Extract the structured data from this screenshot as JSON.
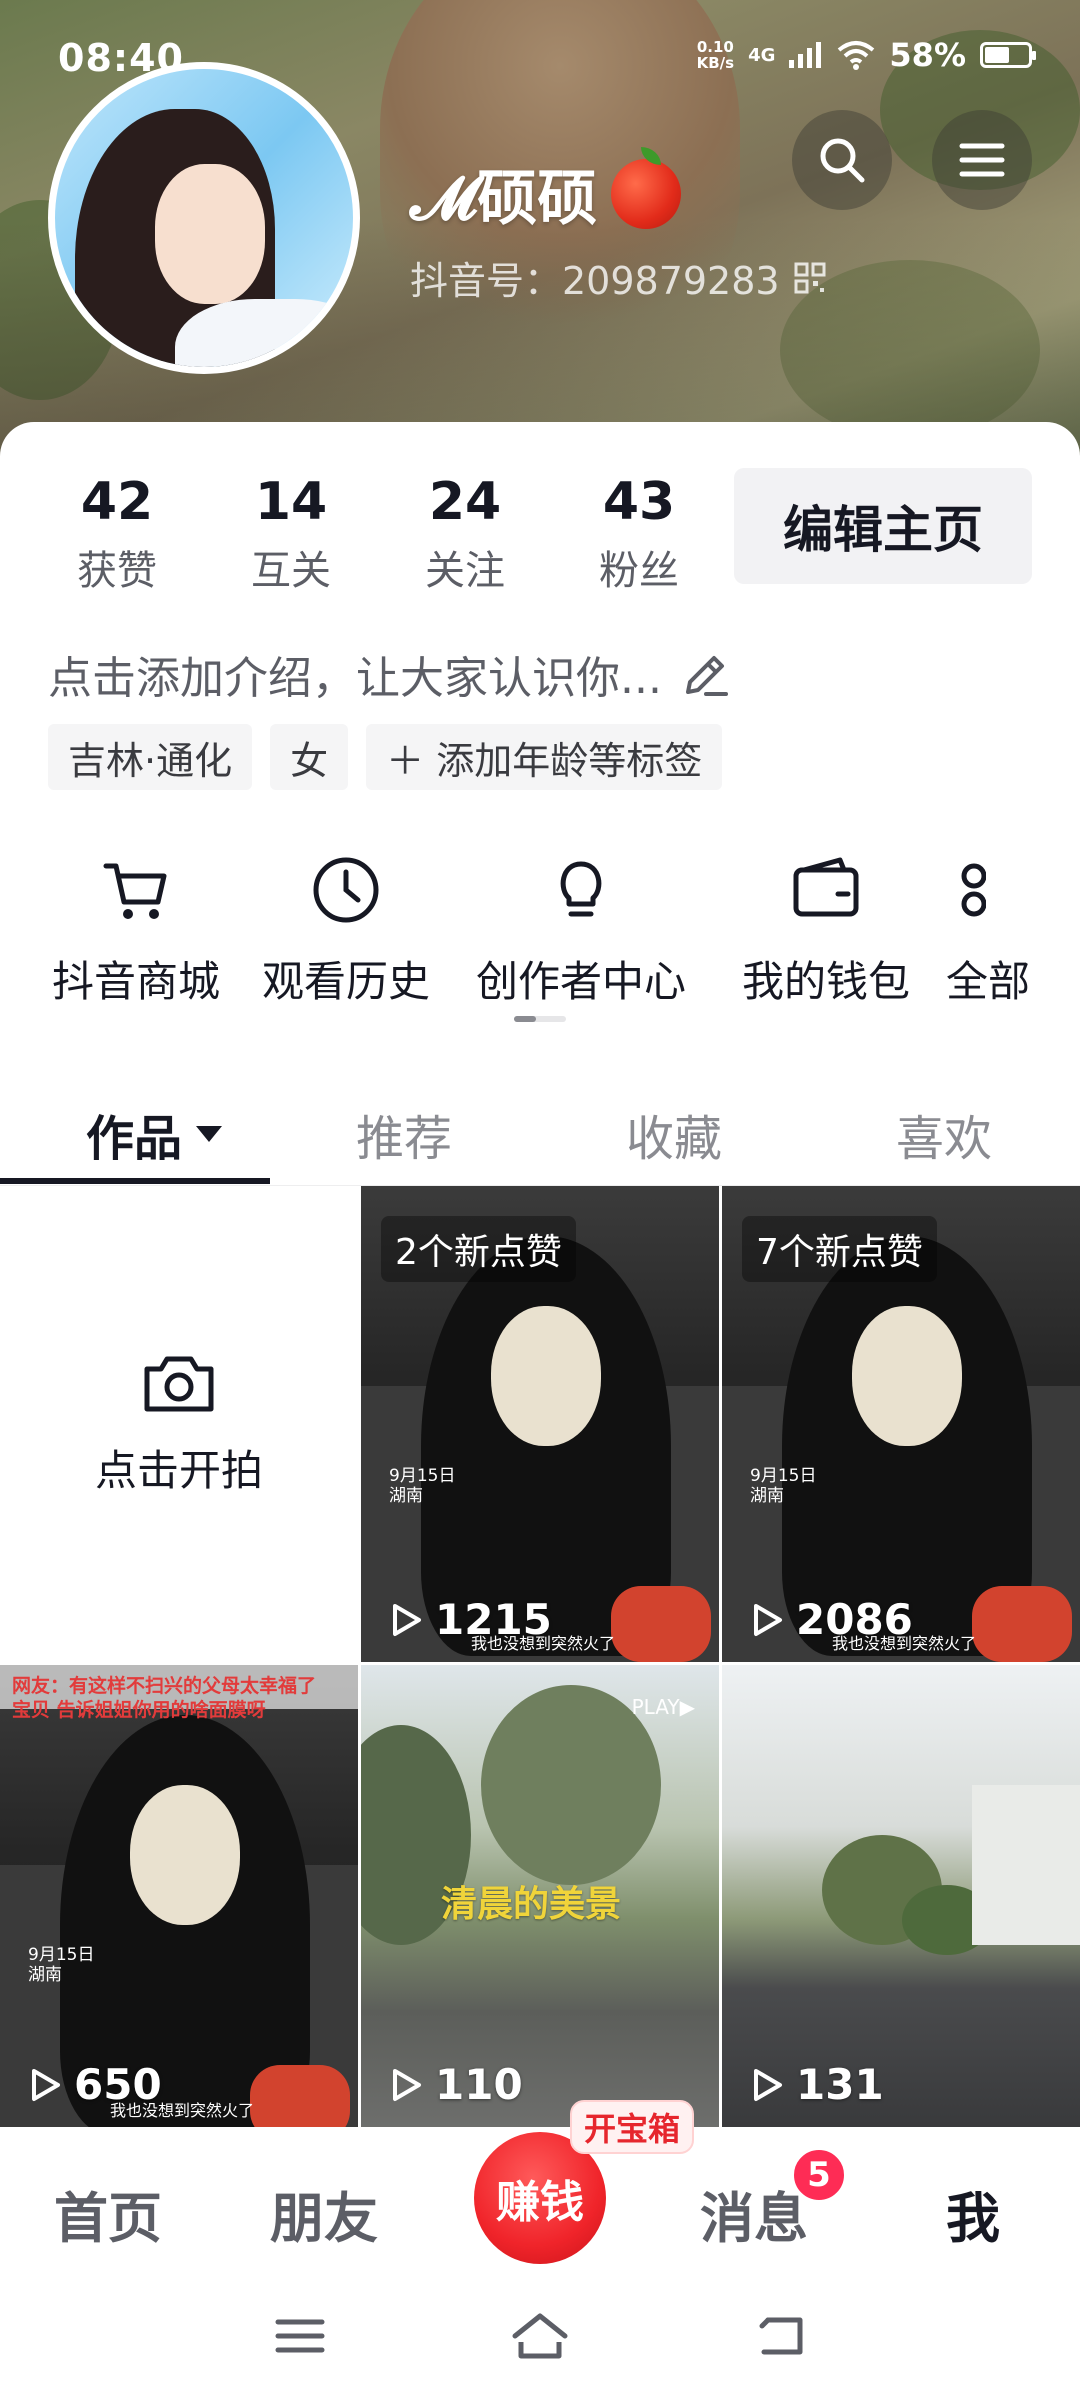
{
  "status_bar": {
    "time": "08:40",
    "net_speed_value": "0.10",
    "net_speed_unit": "KB/s",
    "network": "4G",
    "battery_percent": "58%",
    "battery_level": 0.58
  },
  "profile": {
    "nickname": "𝓜硕硕",
    "douyin_id": "抖音号：209879283",
    "stats": [
      {
        "num": "42",
        "label": "获赞"
      },
      {
        "num": "14",
        "label": "互关"
      },
      {
        "num": "24",
        "label": "关注"
      },
      {
        "num": "43",
        "label": "粉丝"
      }
    ],
    "edit_label": "编辑主页",
    "bio_placeholder": "点击添加介绍，让大家认识你...",
    "tags": [
      "吉林·通化",
      "女",
      "＋ 添加年龄等标签"
    ]
  },
  "tools": [
    {
      "label": "抖音商城",
      "icon": "cart-icon"
    },
    {
      "label": "观看历史",
      "icon": "clock-icon"
    },
    {
      "label": "创作者中心",
      "icon": "lightbulb-icon"
    },
    {
      "label": "我的钱包",
      "icon": "wallet-icon"
    },
    {
      "label": "全部",
      "icon": "more-icon"
    }
  ],
  "tabs": {
    "works": "作品",
    "recommend": "推荐",
    "favorites": "收藏",
    "likes": "喜欢"
  },
  "grid": {
    "shoot_label": "点击开拍",
    "videos": [
      {
        "new_likes": "2个新点赞",
        "plays": "1215"
      },
      {
        "new_likes": "7个新点赞",
        "plays": "2086"
      },
      {
        "plays": "650"
      },
      {
        "plays": "110",
        "title": "清晨的美景",
        "badge": "PLAY▶"
      },
      {
        "plays": "131"
      }
    ],
    "kid_caption_1": "网友：有这样不扫兴的父母太幸福了",
    "kid_caption_2": "宝贝 告诉姐姐你用的啥面膜呀",
    "kid_date": "9月15日",
    "kid_place": "湖南",
    "kid_sub": "我也没想到突然火了"
  },
  "bottom_nav": {
    "home": "首页",
    "friends": "朋友",
    "earn": "赚钱",
    "treasure": "开宝箱",
    "messages": "消息",
    "messages_badge": "5",
    "me": "我"
  },
  "colors": {
    "accent_red": "#fe2c55",
    "text_primary": "#161823",
    "text_secondary": "#5c5e66"
  }
}
